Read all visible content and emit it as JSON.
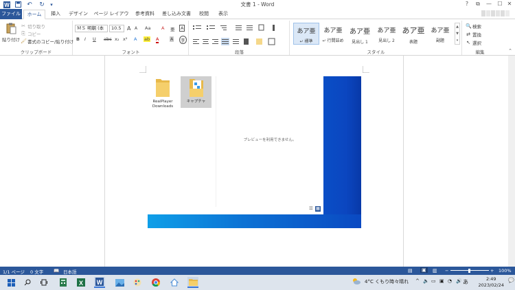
{
  "window": {
    "title": "文書 1 - Word",
    "help": "?",
    "restore": "⧉",
    "minimize": "—",
    "maximize": "☐",
    "close": "✕"
  },
  "quick_access": {
    "undo": "↶",
    "redo": "↻",
    "customize": "▾"
  },
  "tabs": [
    "ファイル",
    "ホーム",
    "挿入",
    "デザイン",
    "ページ レイアウト",
    "参考資料",
    "差し込み文書",
    "校閲",
    "表示"
  ],
  "ribbon": {
    "clipboard": {
      "paste": "貼り付け",
      "cut": "切り取り",
      "copy": "コピー",
      "format_painter": "書式のコピー/貼り付け",
      "label": "クリップボード"
    },
    "font": {
      "font_name": "ＭＳ 明朝 (本",
      "font_size": "10.5",
      "grow": "A",
      "shrink": "A",
      "change_case": "Aa",
      "clear_format": "A",
      "ruby": "亜",
      "border": "A",
      "bold": "B",
      "italic": "I",
      "underline": "U",
      "strike": "abc",
      "subscript": "x₂",
      "superscript": "x²",
      "effects": "A",
      "highlight": "ab",
      "font_color": "A",
      "shading": "A",
      "enclose": "字",
      "label": "フォント"
    },
    "paragraph": {
      "label": "段落"
    },
    "styles": {
      "items": [
        {
          "sample": "あア亜",
          "name": "↵ 標準"
        },
        {
          "sample": "あア亜",
          "name": "↵ 行間詰め"
        },
        {
          "sample": "あア亜",
          "name": "見出し 1"
        },
        {
          "sample": "あア亜",
          "name": "見出し 2"
        },
        {
          "sample": "あア亜",
          "name": "表題"
        },
        {
          "sample": "あア亜",
          "name": "副題"
        }
      ],
      "label": "スタイル"
    },
    "editing": {
      "find": "検索",
      "replace": "置換",
      "select": "選択",
      "label": "編集"
    }
  },
  "document": {
    "folders": [
      {
        "name": "RealPlayer Downloads"
      },
      {
        "name": "キャプチャ"
      }
    ],
    "preview_message": "プレビューを利用できません。"
  },
  "status": {
    "page": "1/1 ページ",
    "words": "0 文字",
    "language": "日本語",
    "zoom": "100%",
    "zoom_minus": "−",
    "zoom_plus": "+"
  },
  "taskbar": {
    "weather": "4°C  くもり時々晴れ",
    "ime": "あ",
    "time": "2:49",
    "date": "2023/02/24"
  },
  "colors": {
    "accent": "#2b579a",
    "taskbar": "#dde4ed",
    "desktop_blue": "#0a4ec6"
  }
}
